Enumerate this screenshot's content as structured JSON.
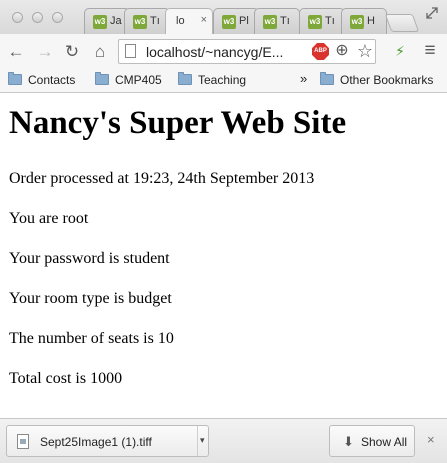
{
  "browser": {
    "tabs": [
      {
        "title": "Ja",
        "favicon": "w3schools-icon",
        "active": false
      },
      {
        "title": "Tı",
        "favicon": "w3schools-icon",
        "active": false
      },
      {
        "title": "lo",
        "favicon": "",
        "active": true,
        "close": "×"
      },
      {
        "title": "Pl",
        "favicon": "w3schools-icon",
        "active": false
      },
      {
        "title": "Tı",
        "favicon": "w3schools-icon",
        "active": false
      },
      {
        "title": "Tı",
        "favicon": "w3schools-icon",
        "active": false
      },
      {
        "title": "H",
        "favicon": "w3schools-icon",
        "active": false
      }
    ],
    "favicon_text": "w3",
    "address": "localhost/~nancyg/E...",
    "adblock_label": "ABP",
    "toolbar_icons": {
      "back": "←",
      "forward": "→",
      "reload": "↻",
      "home": "⌂",
      "search": "⊕",
      "bookmark_star": "☆",
      "extension": "⚡",
      "menu": "≡"
    }
  },
  "bookmarks": {
    "items": [
      "Contacts",
      "CMP405",
      "Teaching"
    ],
    "overflow": "»",
    "other": "Other Bookmarks"
  },
  "page": {
    "heading": "Nancy's Super Web Site",
    "lines": [
      "Order processed at 19:23, 24th September 2013",
      "You are root",
      "Your password is student",
      "Your room type is budget",
      "The number of seats is 10",
      "Total cost is 1000"
    ]
  },
  "downloads": {
    "file_name": "Sept25Image1 (1).tiff",
    "menu_arrow": "▾",
    "show_all_icon": "⬇",
    "show_all": "Show All",
    "close": "×"
  }
}
